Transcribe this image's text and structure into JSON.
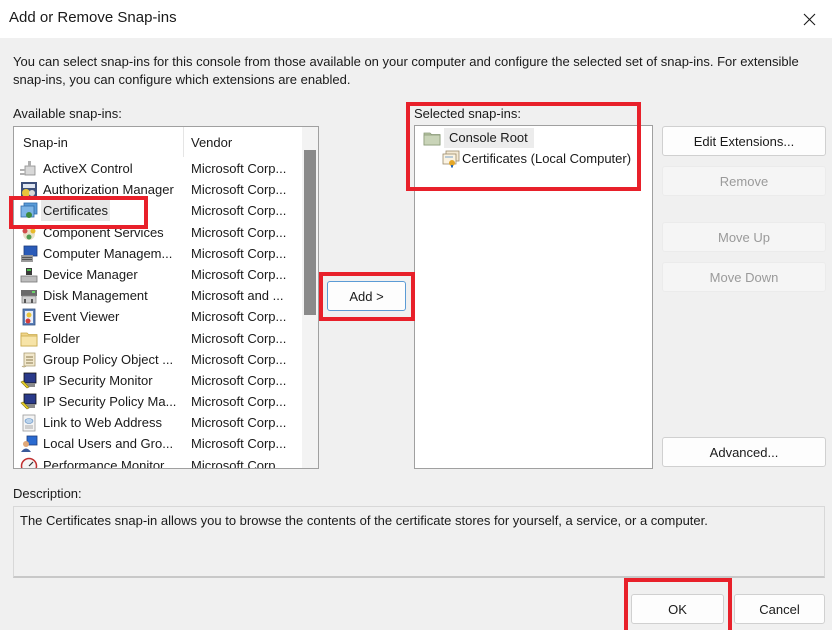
{
  "window": {
    "title": "Add or Remove Snap-ins",
    "close_icon": "close-icon"
  },
  "intro_text": "You can select snap-ins for this console from those available on your computer and configure the selected set of snap-ins. For extensible snap-ins, you can configure which extensions are enabled.",
  "available": {
    "label": "Available snap-ins:",
    "columns": [
      "Snap-in",
      "Vendor"
    ],
    "rows": [
      {
        "name": "ActiveX Control",
        "vendor": "Microsoft Corp...",
        "icon": "activex-control-icon"
      },
      {
        "name": "Authorization Manager",
        "vendor": "Microsoft Corp...",
        "icon": "authorization-manager-icon"
      },
      {
        "name": "Certificates",
        "vendor": "Microsoft Corp...",
        "icon": "certificates-icon",
        "selected": true
      },
      {
        "name": "Component Services",
        "vendor": "Microsoft Corp...",
        "icon": "component-services-icon"
      },
      {
        "name": "Computer Managem...",
        "vendor": "Microsoft Corp...",
        "icon": "computer-management-icon"
      },
      {
        "name": "Device Manager",
        "vendor": "Microsoft Corp...",
        "icon": "device-manager-icon"
      },
      {
        "name": "Disk Management",
        "vendor": "Microsoft and ...",
        "icon": "disk-management-icon"
      },
      {
        "name": "Event Viewer",
        "vendor": "Microsoft Corp...",
        "icon": "event-viewer-icon"
      },
      {
        "name": "Folder",
        "vendor": "Microsoft Corp...",
        "icon": "folder-icon"
      },
      {
        "name": "Group Policy Object ...",
        "vendor": "Microsoft Corp...",
        "icon": "group-policy-icon"
      },
      {
        "name": "IP Security Monitor",
        "vendor": "Microsoft Corp...",
        "icon": "ip-security-monitor-icon"
      },
      {
        "name": "IP Security Policy Ma...",
        "vendor": "Microsoft Corp...",
        "icon": "ip-security-policy-icon"
      },
      {
        "name": "Link to Web Address",
        "vendor": "Microsoft Corp...",
        "icon": "link-web-address-icon"
      },
      {
        "name": "Local Users and Gro...",
        "vendor": "Microsoft Corp...",
        "icon": "local-users-groups-icon"
      },
      {
        "name": "Performance Monitor",
        "vendor": "Microsoft Corp...",
        "icon": "performance-monitor-icon"
      }
    ]
  },
  "add_button": "Add >",
  "selected": {
    "label": "Selected snap-ins:",
    "root": "Console Root",
    "children": [
      "Certificates (Local Computer)"
    ]
  },
  "side_buttons": {
    "edit_extensions": "Edit Extensions...",
    "remove": "Remove",
    "move_up": "Move Up",
    "move_down": "Move Down",
    "advanced": "Advanced..."
  },
  "description": {
    "label": "Description:",
    "text": "The Certificates snap-in allows you to browse the contents of the certificate stores for yourself, a service, or a computer."
  },
  "footer": {
    "ok": "OK",
    "cancel": "Cancel"
  },
  "colors": {
    "highlight": "#e8202a",
    "background": "#f0f0f0"
  }
}
